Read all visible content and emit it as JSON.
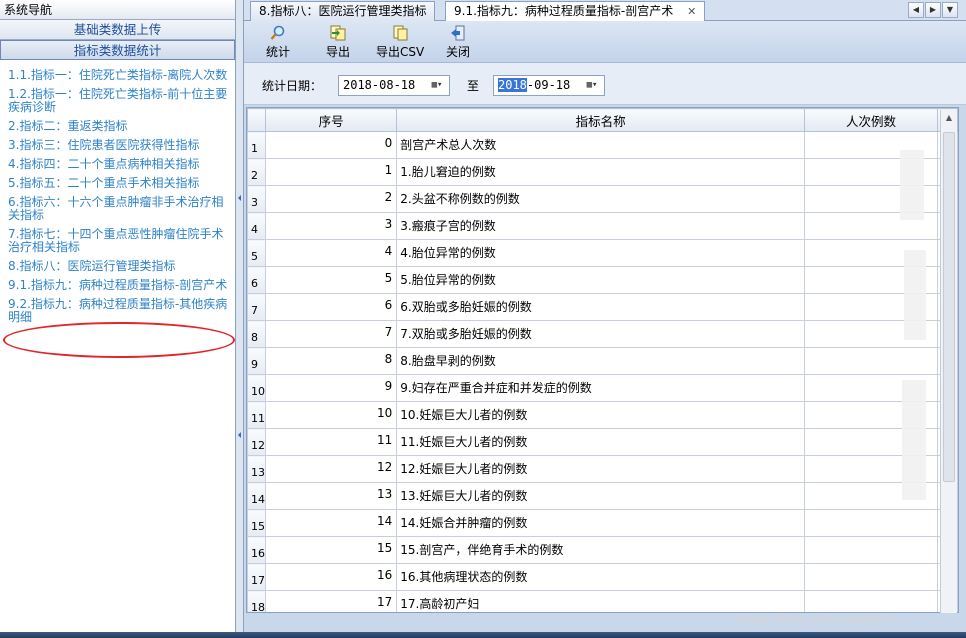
{
  "nav": {
    "header": "系统导航",
    "sections": [
      "基础类数据上传",
      "指标类数据统计"
    ],
    "items": [
      "1.1.指标一：住院死亡类指标-离院人次数",
      "1.2.指标一：住院死亡类指标-前十位主要疾病诊断",
      "2.指标二：重返类指标",
      "3.指标三：住院患者医院获得性指标",
      "4.指标四：二十个重点病种相关指标",
      "5.指标五：二十个重点手术相关指标",
      "6.指标六：十六个重点肿瘤非手术治疗相关指标",
      "7.指标七：十四个重点恶性肿瘤住院手术治疗相关指标",
      "8.指标八：医院运行管理类指标",
      "9.1.指标九：病种过程质量指标-剖宫产术",
      "9.2.指标九：病种过程质量指标-其他疾病明细"
    ]
  },
  "tabs": [
    {
      "label": "8.指标八：医院运行管理类指标"
    },
    {
      "label": "9.1.指标九：病种过程质量指标-剖宫产术"
    }
  ],
  "tab_close": "✕",
  "toolbar": {
    "stats": "统计",
    "export": "导出",
    "export_csv": "导出CSV",
    "close": "关闭"
  },
  "filter": {
    "label": "统计日期：",
    "from": "2018-08-18",
    "to_sep": "至",
    "to_highlight": "2018",
    "to_rest": "-09-18"
  },
  "grid": {
    "columns": [
      "序号",
      "指标名称",
      "人次例数"
    ],
    "rows": [
      {
        "n": "1",
        "seq": "0",
        "name": " 剖宫产术总人次数"
      },
      {
        "n": "2",
        "seq": "1",
        "name": "1.胎儿窘迫的例数"
      },
      {
        "n": "3",
        "seq": "2",
        "name": "2.头盆不称例数的例数"
      },
      {
        "n": "4",
        "seq": "3",
        "name": "3.瘢痕子宫的例数"
      },
      {
        "n": "5",
        "seq": "4",
        "name": "4.胎位异常的例数"
      },
      {
        "n": "6",
        "seq": "5",
        "name": "5.胎位异常的例数"
      },
      {
        "n": "7",
        "seq": "6",
        "name": "6.双胎或多胎妊娠的例数"
      },
      {
        "n": "8",
        "seq": "7",
        "name": "7.双胎或多胎妊娠的例数"
      },
      {
        "n": "9",
        "seq": "8",
        "name": "8.胎盘早剥的例数"
      },
      {
        "n": "10",
        "seq": "9",
        "name": "9.妇存在严重合并症和并发症的例数"
      },
      {
        "n": "11",
        "seq": "10",
        "name": "10.妊娠巨大儿者的例数"
      },
      {
        "n": "12",
        "seq": "11",
        "name": "11.妊娠巨大儿者的例数"
      },
      {
        "n": "13",
        "seq": "12",
        "name": "12.妊娠巨大儿者的例数"
      },
      {
        "n": "14",
        "seq": "13",
        "name": "13.妊娠巨大儿者的例数"
      },
      {
        "n": "15",
        "seq": "14",
        "name": "14.妊娠合并肿瘤的例数"
      },
      {
        "n": "16",
        "seq": "15",
        "name": "15.剖宫产，伴绝育手术的例数"
      },
      {
        "n": "17",
        "seq": "16",
        "name": "16.其他病理状态的例数"
      },
      {
        "n": "18",
        "seq": "17",
        "name": "17.高龄初产妇"
      }
    ]
  },
  "watermark": "https://blog.csdn.net/hghl..."
}
